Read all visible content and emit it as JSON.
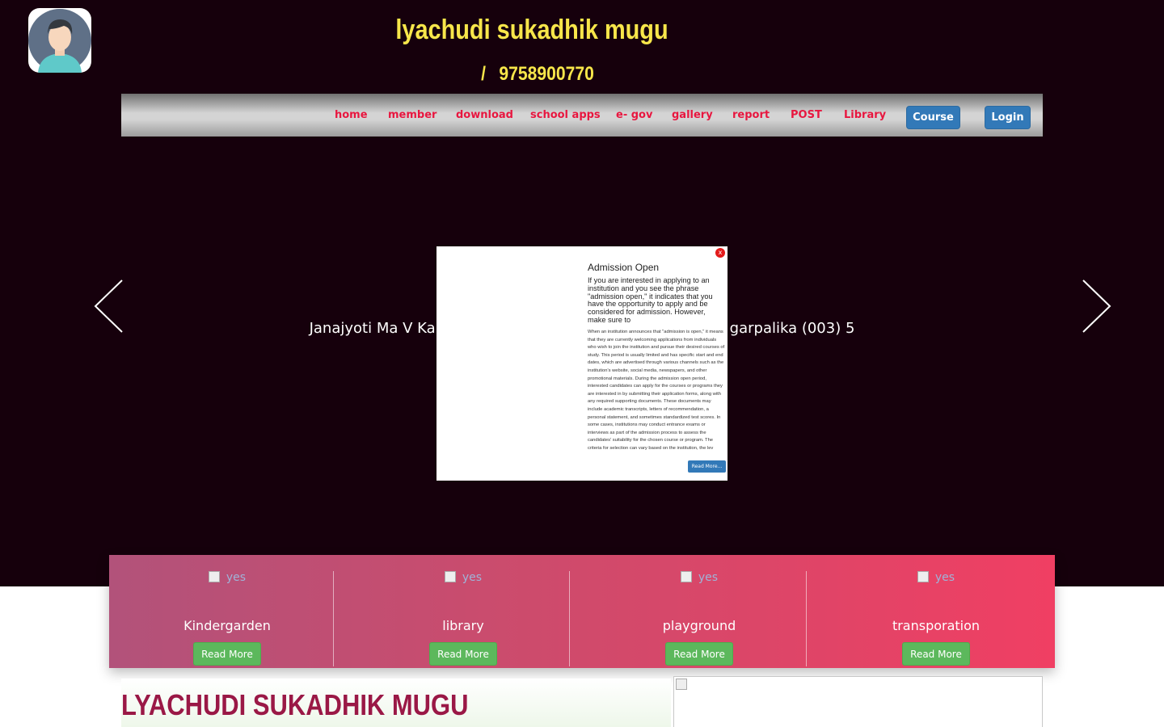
{
  "header": {
    "site_title": "lyachudi sukadhik mugu",
    "phone_line": "/ 9758900770",
    "logo_icon": "avatar-icon"
  },
  "nav": {
    "items": [
      "home",
      "member",
      "download",
      "school apps",
      "e- gov",
      "gallery",
      "report",
      "POST",
      "Library"
    ],
    "course_button": "Course",
    "login_button": "Login",
    "link_color": "#e8163f",
    "button_color": "#3279b8"
  },
  "slider": {
    "caption_left": "Janajyoti Ma V Ka",
    "caption_right": "garpalika (003) 5",
    "prev_icon": "chevron-left-icon",
    "next_icon": "chevron-right-icon"
  },
  "popup": {
    "close_label": "x",
    "title": "Admission Open",
    "lead": "If you are interested in applying to an institution and you see the phrase \"admission open,\" it indicates that you have the opportunity to apply and be considered for admission. However, make sure to",
    "body": "When an institution announces that \"admission is open,\" it means that they are currently welcoming applications from individuals who wish to join the institution and pursue their desired courses of study. This period is usually limited and has specific start and end dates, which are advertised through various channels such as the institution's website, social media, newspapers, and other promotional materials. During the admission open period, interested candidates can apply for the courses or programs they are interested in by submitting their application forms, along with any required supporting documents. These documents may include academic transcripts, letters of recommendation, a personal statement, and sometimes standardized test scores. In some cases, institutions may conduct entrance exams or interviews as part of the admission process to assess the candidates' suitability for the chosen course or program. The criteria for selection can vary based on the institution, the lev",
    "read_more": "Read More..."
  },
  "features": {
    "items": [
      {
        "image_alt": "yes",
        "title": "Kindergarden",
        "button": "Read More"
      },
      {
        "image_alt": "yes",
        "title": "library",
        "button": "Read More"
      },
      {
        "image_alt": "yes",
        "title": "playground",
        "button": "Read More"
      },
      {
        "image_alt": "yes",
        "title": "transporation",
        "button": "Read More"
      }
    ],
    "button_color": "#5cb85c"
  },
  "about": {
    "title": "LYACHUDI SUKADHIK MUGU",
    "title_color": "#9a1846"
  }
}
